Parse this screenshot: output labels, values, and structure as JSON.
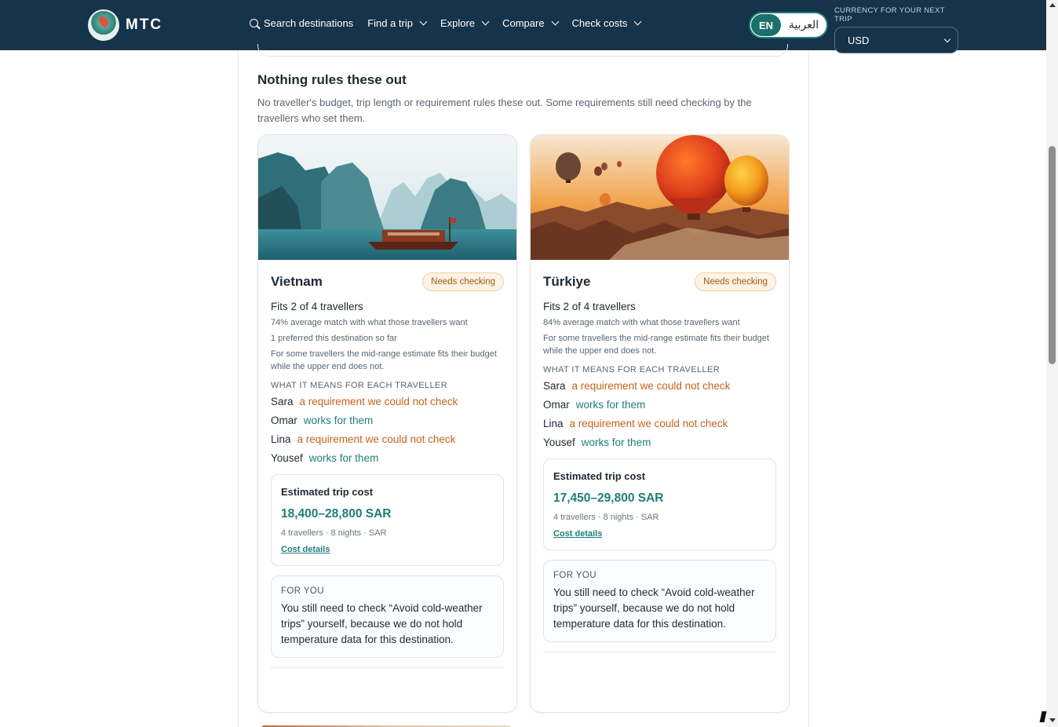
{
  "header": {
    "logo_text": "MTC",
    "nav": {
      "search": "Search destinations",
      "find_trip": "Find a trip",
      "explore": "Explore",
      "compare": "Compare",
      "check_costs": "Check costs"
    },
    "lang": {
      "en": "EN",
      "ar": "العربية"
    },
    "currency_label": "CURRENCY FOR YOUR NEXT TRIP",
    "currency_value": "USD",
    "colors": {
      "bar": "#15334b",
      "accent": "#1b6f6c"
    }
  },
  "section": {
    "title": "Nothing rules these out",
    "subtitle": "No traveller's budget, trip length or requirement rules these out. Some requirements still need checking by the travellers who set them."
  },
  "cards": [
    {
      "name": "Vietnam",
      "badge": "Needs checking",
      "fits": "Fits 2 of 4 travellers",
      "notes": [
        "74% average match with what those travellers want",
        "1 preferred this destination so far",
        "For some travellers the mid-range estimate fits their budget while the upper end does not."
      ],
      "meaning_title": "WHAT IT MEANS FOR EACH TRAVELLER",
      "travellers": [
        {
          "name": "Sara",
          "status": "a requirement we could not check"
        },
        {
          "name": "Omar",
          "status": "works for them"
        },
        {
          "name": "Lina",
          "status": "a requirement we could not check"
        },
        {
          "name": "Yousef",
          "status": "works for them"
        }
      ],
      "cost": {
        "label": "Estimated trip cost",
        "value": "18,400–28,800 SAR",
        "meta": "4 travellers · 8 nights · SAR",
        "link": "Cost details"
      },
      "for_you": {
        "label": "FOR YOU",
        "text": "You still need to check “Avoid cold-weather trips” yourself, because we do not hold temperature data for this destination."
      }
    },
    {
      "name": "Türkiye",
      "badge": "Needs checking",
      "fits": "Fits 2 of 4 travellers",
      "notes": [
        "84% average match with what those travellers want",
        "For some travellers the mid-range estimate fits their budget while the upper end does not."
      ],
      "meaning_title": "WHAT IT MEANS FOR EACH TRAVELLER",
      "travellers": [
        {
          "name": "Sara",
          "status": "a requirement we could not check"
        },
        {
          "name": "Omar",
          "status": "works for them"
        },
        {
          "name": "Lina",
          "status": "a requirement we could not check"
        },
        {
          "name": "Yousef",
          "status": "works for them"
        }
      ],
      "cost": {
        "label": "Estimated trip cost",
        "value": "17,450–29,800 SAR",
        "meta": "4 travellers · 8 nights · SAR",
        "link": "Cost details"
      },
      "for_you": {
        "label": "FOR YOU",
        "text": "You still need to check “Avoid cold-weather trips” yourself, because we do not hold temperature data for this destination."
      }
    }
  ]
}
